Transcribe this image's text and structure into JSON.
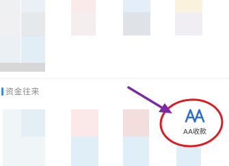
{
  "section": {
    "title": "资金往来"
  },
  "aa_payment": {
    "label": "AA收款",
    "icon": "aa-logo-icon",
    "icon_color": "#2f6fcf"
  },
  "annotation": {
    "arrow_color": "#7b2aa3",
    "circle_color": "#e0191f"
  },
  "blurred_tile_colors": [
    "#eef0f2",
    "#eaf0f5",
    "#fbeaea",
    "#e3eef8",
    "#fbf2dd",
    "#f0f0f2",
    "#e6e9ec",
    "#f5eeee",
    "#dfe2e6",
    "#f1eef3",
    "#eaf0f4",
    "#e2eef6",
    "#d7d7d7",
    "#f0f5f8",
    "#e4eef5",
    "#fbe8e8",
    "#f3dede",
    "#e0eef8"
  ]
}
